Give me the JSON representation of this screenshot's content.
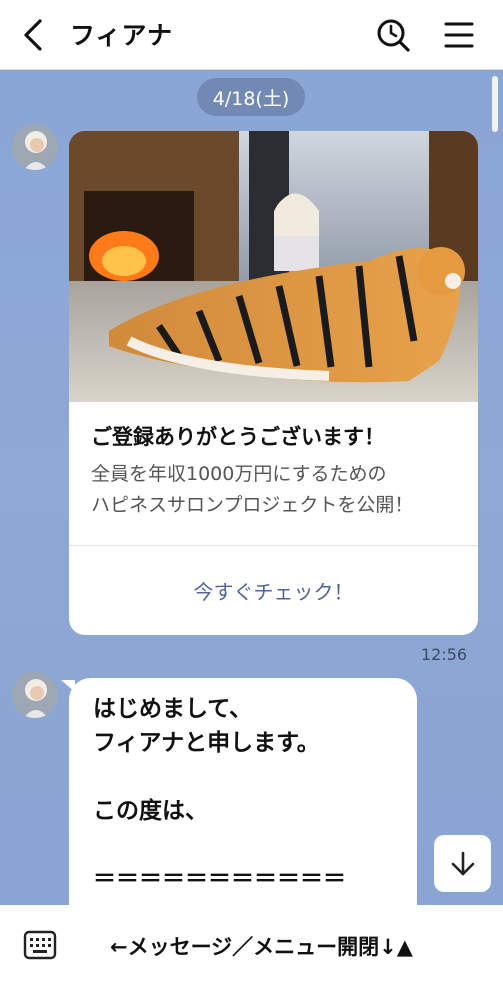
{
  "header": {
    "title": "フィアナ",
    "icons": {
      "back": "chevron-left-icon",
      "search": "search-history-icon",
      "menu": "hamburger-menu-icon"
    }
  },
  "chat": {
    "date_label": "4/18(土)",
    "card": {
      "title": "ご登録ありがとうございます！",
      "desc_line1": "全員を年収1000万円にするための",
      "desc_line2": "ハピネスサロンプロジェクトを公開！",
      "link_label": "今すぐチェック！",
      "link_color": "#50669a"
    },
    "card_time": "12:56",
    "message": {
      "line1": "はじめまして、",
      "line2": "フィアナと申します。",
      "line3": "",
      "line4": "この度は、",
      "line5": "",
      "line6": "＝＝＝＝＝＝＝＝＝＝＝"
    }
  },
  "footer": {
    "keyboard_icon": "keyboard-icon",
    "menu_label": "←メッセージ／メニュー開閉↓▲"
  },
  "colors": {
    "chat_bg": "#8da8d6",
    "date_pill": "#7389b5",
    "header_bg": "#ffffff"
  }
}
